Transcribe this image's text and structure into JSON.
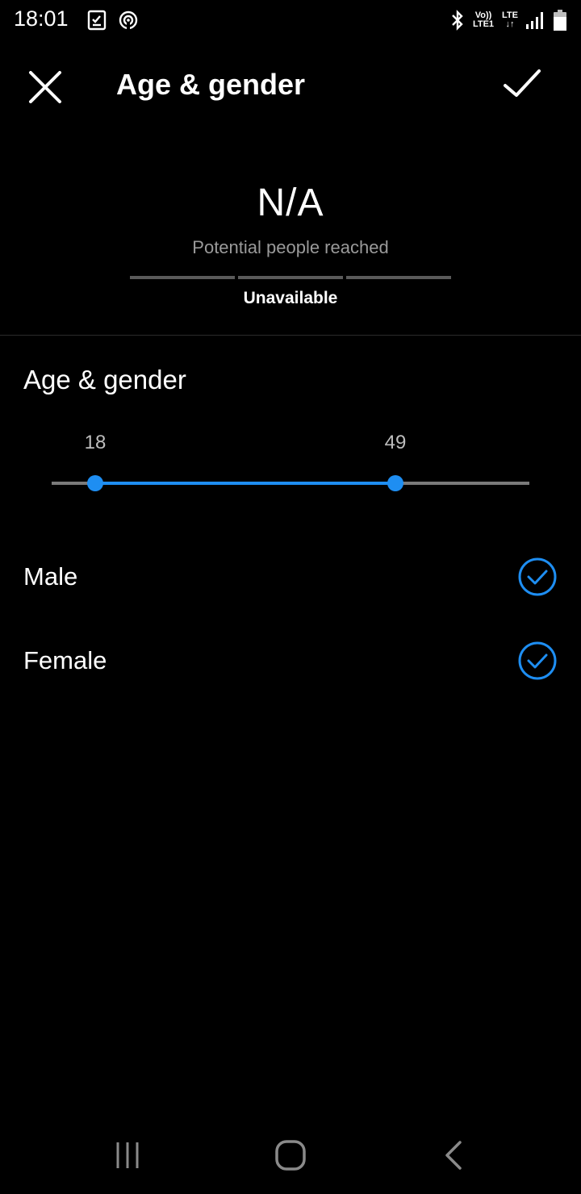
{
  "status_bar": {
    "time": "18:01",
    "left_icons": [
      "checklist-icon",
      "hotspot-icon"
    ],
    "right_icons": [
      "bluetooth-icon",
      "volte-icon",
      "lte-icon",
      "signal-icon",
      "battery-icon"
    ],
    "volte_text": "Vo))",
    "lte1_text": "LTE1",
    "lte_text": "LTE"
  },
  "header": {
    "title": "Age & gender",
    "close_icon": "close-icon",
    "confirm_icon": "checkmark-icon"
  },
  "reach": {
    "value": "N/A",
    "label": "Potential people reached",
    "status": "Unavailable"
  },
  "age": {
    "title": "Age & gender",
    "min_label": "18",
    "max_label": "49",
    "selected_min": 18,
    "selected_max": 49,
    "accent_color": "#1e8ef2"
  },
  "gender": {
    "options": [
      {
        "label": "Male",
        "checked": true
      },
      {
        "label": "Female",
        "checked": true
      }
    ]
  },
  "nav_bar": {
    "icons": [
      "recent-apps-icon",
      "home-icon",
      "back-icon"
    ]
  }
}
